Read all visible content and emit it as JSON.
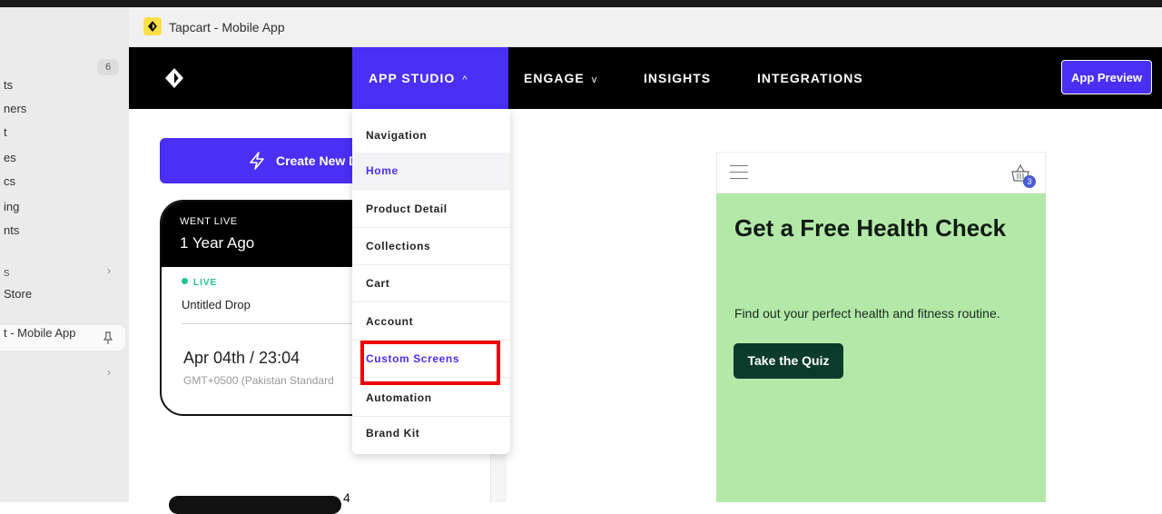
{
  "sidebar": {
    "badge": "6",
    "items": [
      {
        "label": "ts"
      },
      {
        "label": "ners"
      },
      {
        "label": "t"
      },
      {
        "label": "es"
      },
      {
        "label": "cs"
      },
      {
        "label": "ing"
      },
      {
        "label": "nts"
      },
      {
        "label": "s"
      },
      {
        "label": "Store"
      },
      {
        "label": "t - Mobile App"
      }
    ],
    "chevron": "›"
  },
  "titlebar": {
    "title": "Tapcart - Mobile App"
  },
  "nav": {
    "items": [
      {
        "label": "APP STUDIO",
        "chevron": "^"
      },
      {
        "label": "ENGAGE",
        "chevron": "v"
      },
      {
        "label": "INSIGHTS"
      },
      {
        "label": "INTEGRATIONS"
      }
    ],
    "preview_button": "App Preview"
  },
  "main": {
    "create_button": "Create New D",
    "card": {
      "status_header": "WENT LIVE",
      "ago": "1 Year Ago",
      "live_label": "LIVE",
      "drop_name": "Untitled Drop",
      "date": "Apr 04th / 23:04",
      "timezone": "GMT+0500 (Pakistan Standard"
    },
    "card2_badge": "4"
  },
  "dropdown": {
    "items": [
      {
        "label": "Navigation"
      },
      {
        "label": "Home"
      },
      {
        "label": "Product Detail"
      },
      {
        "label": "Collections"
      },
      {
        "label": "Cart"
      },
      {
        "label": "Account"
      },
      {
        "label": "Custom Screens"
      },
      {
        "label": "Automation"
      },
      {
        "label": "Brand Kit"
      }
    ]
  },
  "preview": {
    "cart_count": "3",
    "hero_title": "Get a Free Health Check",
    "hero_subtitle": "Find out your perfect health and fitness routine.",
    "cta": "Take the Quiz"
  },
  "colors": {
    "accent": "#4a2ff5",
    "hero_bg": "#b3e8a8",
    "cta_bg": "#0b3b2a",
    "highlight": "#ee0000",
    "live": "#22c58b"
  }
}
